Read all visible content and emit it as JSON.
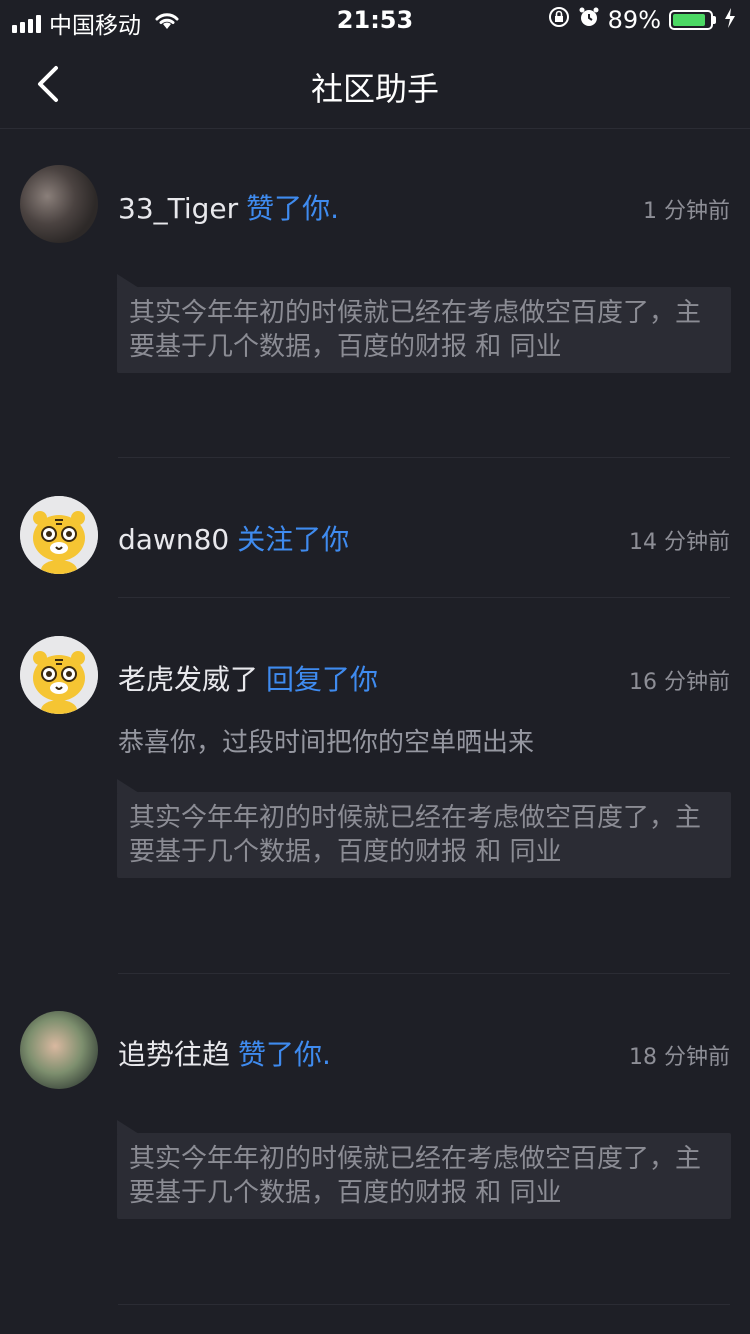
{
  "status_bar": {
    "carrier": "中国移动",
    "time": "21:53",
    "battery_percent": "89%",
    "battery_level": 0.89
  },
  "nav": {
    "title": "社区助手",
    "back_icon": "chevron-left-icon"
  },
  "notifications": [
    {
      "user": "33_Tiger",
      "action": "赞了你.",
      "time": "1 分钟前",
      "avatar": "photo",
      "quote": "其实今年年初的时候就已经在考虑做空百度了，主要基于几个数据，百度的财报 和 同业"
    },
    {
      "user": "dawn80",
      "action": "关注了你",
      "time": "14 分钟前",
      "avatar": "tiger"
    },
    {
      "user": "老虎发威了",
      "action": "回复了你",
      "time": "16 分钟前",
      "avatar": "tiger",
      "reply": "恭喜你，过段时间把你的空单晒出来",
      "quote": "其实今年年初的时候就已经在考虑做空百度了，主要基于几个数据，百度的财报 和 同业"
    },
    {
      "user": "追势往趋",
      "action": "赞了你.",
      "time": "18 分钟前",
      "avatar": "photo",
      "quote": "其实今年年初的时候就已经在考虑做空百度了，主要基于几个数据，百度的财报 和 同业"
    }
  ],
  "colors": {
    "background": "#1e1f26",
    "accent": "#3f8bef",
    "quote_bg": "#2b2c34"
  }
}
